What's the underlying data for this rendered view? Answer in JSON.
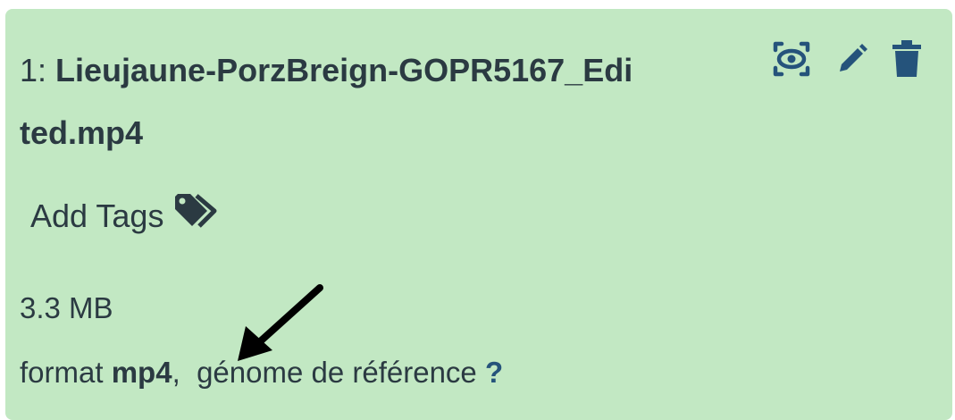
{
  "dataset": {
    "hid": "1:",
    "name_line1": "Lieujaune-PorzBreign-GOPR5167_Edi",
    "name_line2": "ted.mp4",
    "add_tags_label": "Add Tags",
    "size": "3.3 MB",
    "format_prefix": "format",
    "format_value": "mp4",
    "format_separator": ",",
    "genome_label": "génome de référence",
    "genome_value": "?"
  },
  "icons": {
    "view": "eye-icon",
    "edit": "pencil-icon",
    "delete": "trash-icon",
    "tags": "tags-icon",
    "annotation": "arrow-icon"
  },
  "colors": {
    "card_background": "#c2e8c3",
    "text": "#2b3a42",
    "icon": "#25537b",
    "arrow": "#000000"
  }
}
